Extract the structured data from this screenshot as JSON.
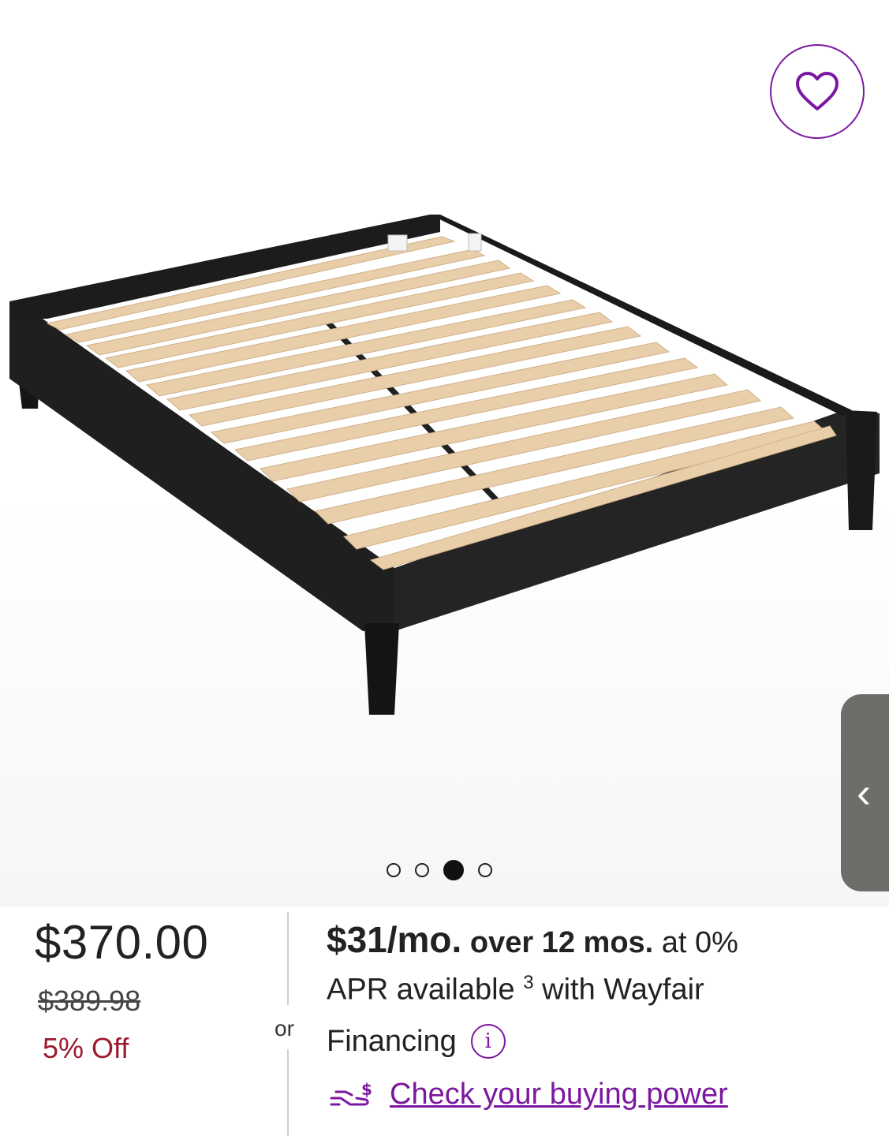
{
  "product": {
    "image_alt": "Black wood platform bed frame with natural wood slats",
    "image_indicator": {
      "count": 4,
      "active_index": 2
    }
  },
  "favorite": {
    "icon": "heart-icon"
  },
  "side_tab": {
    "icon": "chevron-left-icon",
    "glyph": "‹"
  },
  "pricing": {
    "price": "$370.00",
    "was_price": "$389.98",
    "discount": "5% Off"
  },
  "divider_label": "or",
  "financing": {
    "monthly": "$31/mo.",
    "term": "over 12 mos.",
    "rate_suffix": "at 0%",
    "line2_prefix": "APR available",
    "footnote": "3",
    "line2_suffix": "with Wayfair",
    "line3": "Financing",
    "info_icon": "info-icon",
    "info_glyph": "i",
    "buying_power_icon": "hand-dollar-icon",
    "buying_power_link": "Check your buying power"
  },
  "colors": {
    "brand_purple": "#7b189f",
    "discount_red": "#9b1b30",
    "side_tab_gray": "#6f6d6a"
  }
}
